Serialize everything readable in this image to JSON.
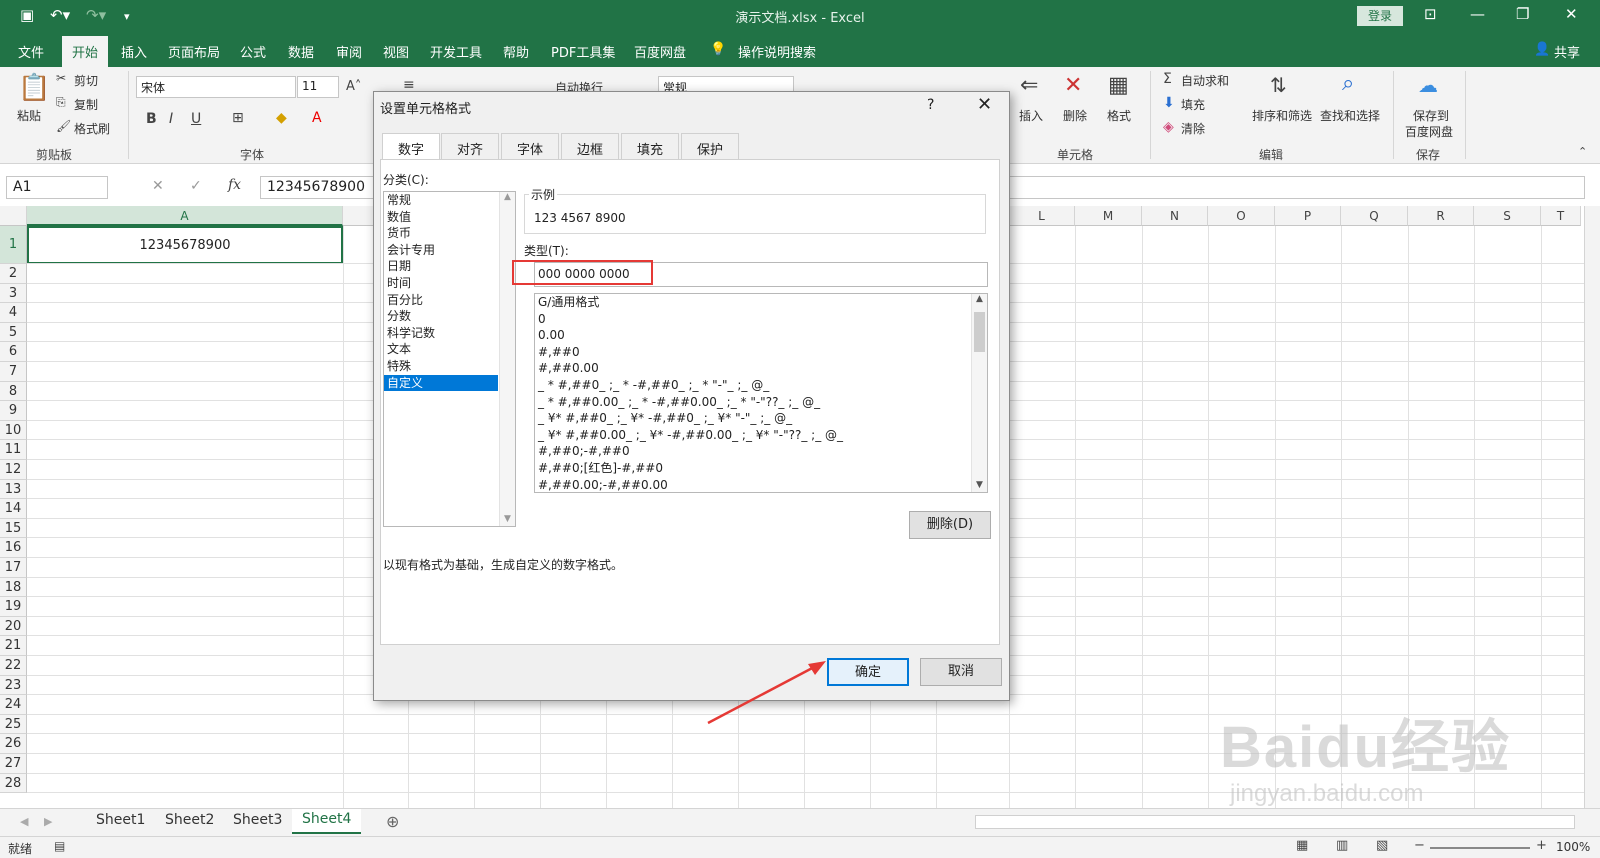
{
  "window": {
    "title": "演示文档.xlsx  -  Excel",
    "login": "登录"
  },
  "ribbon_tabs": [
    "文件",
    "开始",
    "插入",
    "页面布局",
    "公式",
    "数据",
    "审阅",
    "视图",
    "开发工具",
    "帮助",
    "PDF工具集",
    "百度网盘"
  ],
  "tell_me": "操作说明搜索",
  "share": "共享",
  "ribbon": {
    "paste": "粘贴",
    "cut": "剪切",
    "copy": "复制",
    "format_painter": "格式刷",
    "clipboard_group": "剪贴板",
    "font_name": "宋体",
    "font_size": "11",
    "font_group": "字体",
    "wrap_text": "自动换行",
    "number_format": "常规",
    "insert": "插入",
    "delete": "删除",
    "format": "格式",
    "cells_group": "单元格",
    "autosum": "自动求和",
    "fill": "填充",
    "clear": "清除",
    "sort_filter": "排序和筛选",
    "find_select": "查找和选择",
    "editing_group": "编辑",
    "save_to": "保存到",
    "baidu_netdisk": "百度网盘",
    "save_group": "保存"
  },
  "formula_bar": {
    "name_box": "A1",
    "fx": "fx",
    "value": "12345678900"
  },
  "grid": {
    "columns": [
      "A",
      "L",
      "M",
      "N",
      "O",
      "P",
      "Q",
      "R",
      "S",
      "T"
    ],
    "rows": [
      "1",
      "2",
      "3",
      "4",
      "5",
      "6",
      "7",
      "8",
      "9",
      "10",
      "11",
      "12",
      "13",
      "14",
      "15",
      "16",
      "17",
      "18",
      "19",
      "20",
      "21",
      "22",
      "23",
      "24",
      "25",
      "26",
      "27",
      "28"
    ],
    "a1_value": "12345678900"
  },
  "sheets": [
    "Sheet1",
    "Sheet2",
    "Sheet3",
    "Sheet4"
  ],
  "active_sheet": "Sheet4",
  "status": {
    "ready": "就绪",
    "zoom": "100%"
  },
  "dialog": {
    "title": "设置单元格格式",
    "help": "?",
    "tabs": [
      "数字",
      "对齐",
      "字体",
      "边框",
      "填充",
      "保护"
    ],
    "category_label": "分类(C):",
    "categories": [
      "常规",
      "数值",
      "货币",
      "会计专用",
      "日期",
      "时间",
      "百分比",
      "分数",
      "科学记数",
      "文本",
      "特殊",
      "自定义"
    ],
    "selected_category": "自定义",
    "sample_label": "示例",
    "sample_value": "123 4567 8900",
    "type_label": "类型(T):",
    "type_value": "000 0000 0000",
    "formats": [
      "G/通用格式",
      "0",
      "0.00",
      "#,##0",
      "#,##0.00",
      "_ * #,##0_ ;_ * -#,##0_ ;_ * \"-\"_ ;_ @_",
      "_ * #,##0.00_ ;_ * -#,##0.00_ ;_ * \"-\"??_ ;_ @_",
      "_ ¥* #,##0_ ;_ ¥* -#,##0_ ;_ ¥* \"-\"_ ;_ @_",
      "_ ¥* #,##0.00_ ;_ ¥* -#,##0.00_ ;_ ¥* \"-\"??_ ;_ @_",
      "#,##0;-#,##0",
      "#,##0;[红色]-#,##0",
      "#,##0.00;-#,##0.00"
    ],
    "delete_button": "删除(D)",
    "description": "以现有格式为基础，生成自定义的数字格式。",
    "ok": "确定",
    "cancel": "取消"
  },
  "colors": {
    "excel_green": "#217346",
    "highlight_red": "#e53935",
    "selection_blue": "#0078d7"
  },
  "watermark": {
    "brand": "Baidu经验",
    "url": "jingyan.baidu.com"
  }
}
